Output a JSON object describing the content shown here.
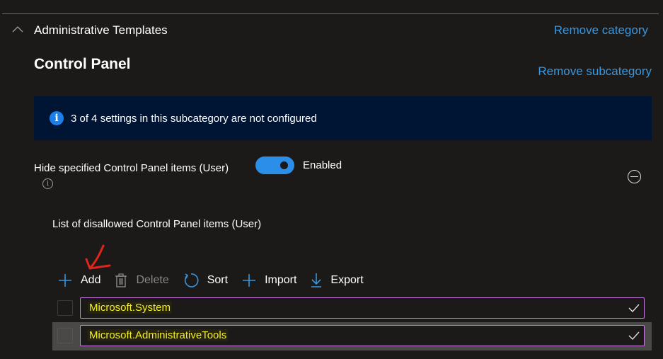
{
  "category": {
    "title": "Administrative Templates",
    "remove_label": "Remove category"
  },
  "subcategory": {
    "title": "Control Panel",
    "remove_label": "Remove subcategory"
  },
  "info_banner": {
    "icon": "info-icon",
    "text": "3 of 4 settings in this subcategory are not configured"
  },
  "setting": {
    "label": "Hide specified Control Panel items (User)",
    "toggle_state": "Enabled",
    "toggle_on": true
  },
  "list": {
    "label": "List of disallowed Control Panel items (User)",
    "toolbar": {
      "add": "Add",
      "delete": "Delete",
      "sort": "Sort",
      "import": "Import",
      "export": "Export"
    },
    "items": [
      {
        "value": "Microsoft.System",
        "selected": false
      },
      {
        "value": "Microsoft.AdministrativeTools",
        "selected": false
      }
    ]
  },
  "colors": {
    "background": "#1b1a19",
    "link": "#3a96dd",
    "banner": "#001433",
    "toggle": "#2b8ee8",
    "field_border": "#c77ddc",
    "highlight_text": "#f4ef22",
    "annotation_arrow": "#e0241b"
  }
}
